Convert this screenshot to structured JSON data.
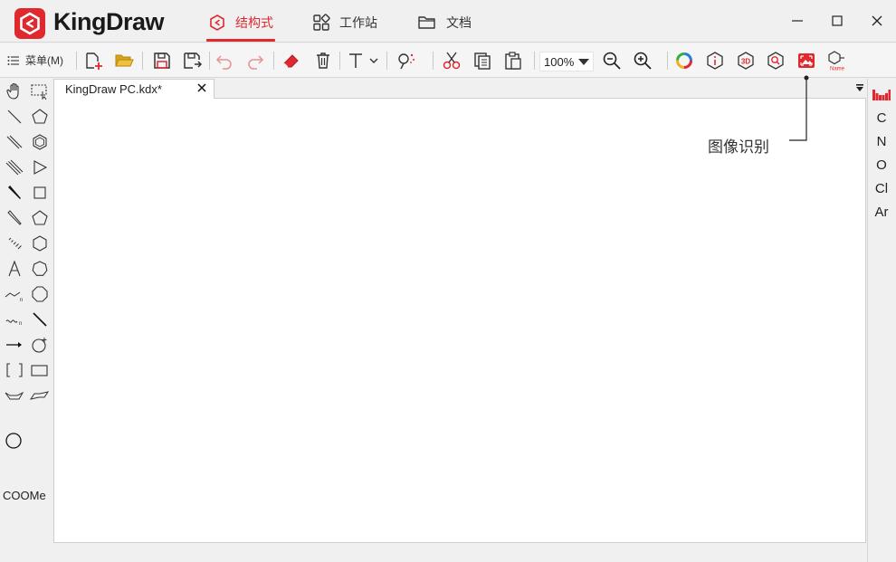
{
  "app": {
    "name": "KingDraw",
    "brand_color": "#e0282f"
  },
  "nav": {
    "tabs": [
      {
        "label": "结构式",
        "icon": "structure-icon",
        "active": true
      },
      {
        "label": "工作站",
        "icon": "grid-icon",
        "active": false
      },
      {
        "label": "文档",
        "icon": "folder-icon",
        "active": false
      }
    ]
  },
  "window_controls": [
    "minimize-icon",
    "maximize-icon",
    "close-icon"
  ],
  "toolbar": {
    "menu_label": "菜单(M)",
    "zoom_value": "100%",
    "icons": [
      "new-file-icon",
      "open-folder-icon",
      "save-icon",
      "save-as-icon",
      "undo-icon",
      "redo-icon",
      "eraser-icon",
      "delete-icon",
      "text-align-icon",
      "clean-structure-icon",
      "cut-icon",
      "copy-icon",
      "paste-icon",
      "zoom-out-icon",
      "zoom-in-icon",
      "color-ring-icon",
      "info-icon",
      "3d-icon",
      "search-structure-icon",
      "image-recognition-icon",
      "name-to-structure-icon"
    ]
  },
  "document": {
    "tab_label": "KingDraw PC.kdx*"
  },
  "left_tools": {
    "text_tool": "COOMe"
  },
  "right_panel": {
    "elements": [
      "C",
      "N",
      "O",
      "Cl",
      "Ar"
    ]
  },
  "callout": {
    "text": "图像识别"
  }
}
